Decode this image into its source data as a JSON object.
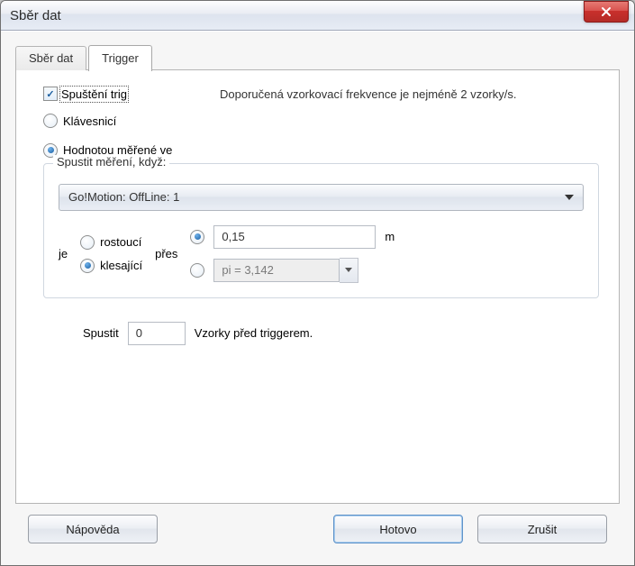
{
  "window": {
    "title": "Sběr dat"
  },
  "tabs": {
    "data": "Sběr dat",
    "trigger": "Trigger"
  },
  "trigger": {
    "enable_label": "Spuštění trig",
    "keyboard_label": "Klávesnicí",
    "hint": "Doporučená vzorkovací frekvence je nejméně 2 vzorky/s.",
    "by_value_label": "Hodnotou měřené ve",
    "start_when_legend": "Spustit měření, když:",
    "source_selected": "Go!Motion: OffLine: 1",
    "je_label": "je",
    "rising_label": "rostoucí",
    "falling_label": "klesající",
    "pres_label": "přes",
    "threshold_value": "0,15",
    "threshold_unit": "m",
    "expr_value": "pi = 3,142",
    "pre_samples_label1": "Spustit",
    "pre_samples_value": "0",
    "pre_samples_label2": "Vzorky před triggerem."
  },
  "buttons": {
    "help": "Nápověda",
    "done": "Hotovo",
    "cancel": "Zrušit"
  }
}
